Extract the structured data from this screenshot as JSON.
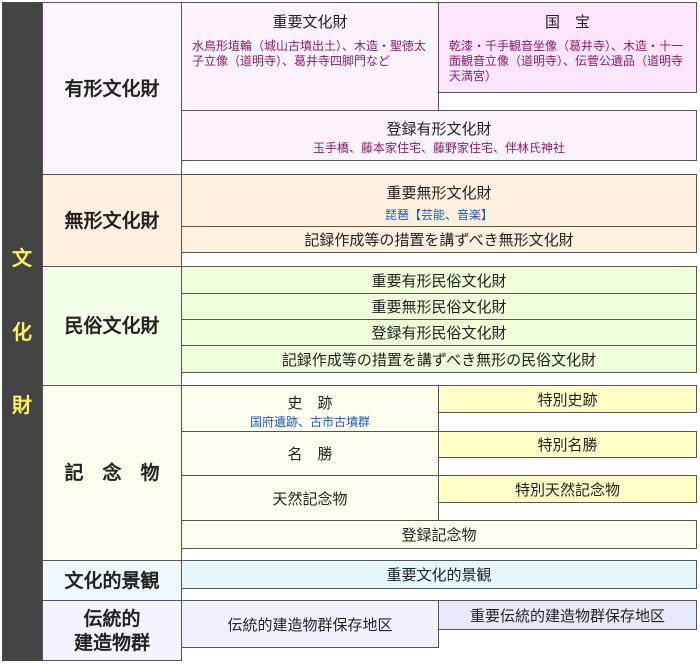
{
  "sidebar": {
    "chars": [
      "文",
      "化",
      "財"
    ]
  },
  "yukei": {
    "label": "有形文化財",
    "juyo": {
      "title": "重要文化財",
      "examples": "水鳥形埴輪（城山古墳出土）、木造・聖徳太子立像（道明寺）、葛井寺四脚門など"
    },
    "kokuho": {
      "title": "国　宝",
      "examples": "乾漆・千手観音坐像（葛井寺）、木造・十一面観音立像（道明寺）、伝菅公遺品（道明寺天満宮）"
    },
    "toroku": {
      "title": "登録有形文化財",
      "examples": "玉手橋、藤本家住宅、藤野家住宅、伴林氏神社"
    }
  },
  "mukei": {
    "label": "無形文化財",
    "juyo": {
      "title": "重要無形文化財",
      "examples": "琵琶【芸能、音楽】"
    },
    "kiroku": "記録作成等の措置を講ずべき無形文化財"
  },
  "minzoku": {
    "label": "民俗文化財",
    "rows": [
      "重要有形民俗文化財",
      "重要無形民俗文化財",
      "登録有形民俗文化財",
      "記録作成等の措置を講ずべき無形の民俗文化財"
    ]
  },
  "kinenbutsu": {
    "label": "記　念　物",
    "shiseki": {
      "title": "史　跡",
      "examples": "国府遺跡、古市古墳群",
      "special": "特別史跡"
    },
    "meisho": {
      "title": "名　勝",
      "special": "特別名勝"
    },
    "tennen": {
      "title": "天然記念物",
      "special": "特別天然記念物"
    },
    "toroku": "登録記念物"
  },
  "keikan": {
    "label": "文化的景観",
    "item": "重要文化的景観"
  },
  "dento": {
    "label_line1": "伝統的",
    "label_line2": "建造物群",
    "hozon": "伝統的建造物群保存地区",
    "juyo": "重要伝統的建造物群保存地区"
  },
  "colors": {
    "sidebar": "#444444",
    "sidebar_text": "#ffee66",
    "pink": "#fdf3fd",
    "magenta": "#fde6fc",
    "orange": "#fff0df",
    "green": "#eefed8",
    "cream": "#fffff0",
    "yellow": "#ffffc8",
    "blue": "#e6f6fd",
    "lavender": "#f1f1fd",
    "example_text": "#8a1c6f",
    "example_blue": "#1a56c8"
  }
}
